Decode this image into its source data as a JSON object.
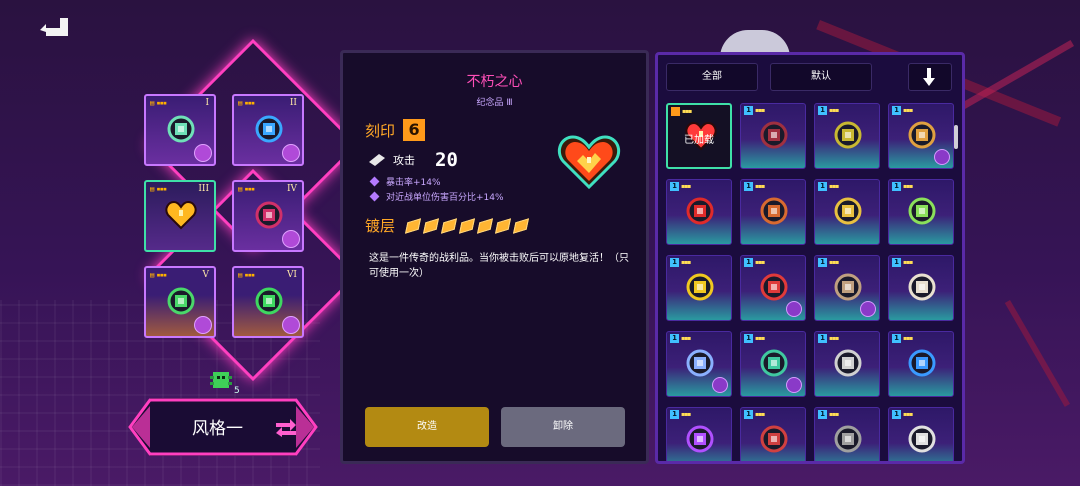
{
  "header": {
    "back_icon": "back-arrow-icon"
  },
  "equipped_slots": [
    {
      "numeral": "I",
      "rarity": "▤ ▪▪▪",
      "icon": "sword-gem-icon"
    },
    {
      "numeral": "II",
      "rarity": "▤ ▪▪▪",
      "icon": "eye-orb-icon"
    },
    {
      "numeral": "III",
      "rarity": "▤ ▪▪▪",
      "icon": "golden-heart-icon"
    },
    {
      "numeral": "IV",
      "rarity": "▤ ▪▪▪",
      "icon": "dark-crystal-icon"
    },
    {
      "numeral": "V",
      "rarity": "▤ ▪▪▪",
      "icon": "green-flower-icon"
    },
    {
      "numeral": "VI",
      "rarity": "▤ ▪▪▪",
      "icon": "green-cactus-icon"
    }
  ],
  "style": {
    "label": "风格一",
    "count": "5",
    "icon": "bug-icon",
    "swap_icon": "swap-arrows-icon"
  },
  "detail": {
    "title": "不朽之心",
    "subtitle": "纪念品 Ⅲ",
    "engrave_label": "刻印",
    "engrave_value": "6",
    "attack_label": "攻击",
    "attack_value": "20",
    "bonus_1": "暴击率+14%",
    "bonus_2": "对近战单位伤害百分比+14%",
    "plating_label": "镀层",
    "plating_level": 7,
    "description": "这是一件传奇的战利品。当你被击败后可以原地复活！（只可使用一次）",
    "reforge_button": "改造",
    "remove_button": "卸除"
  },
  "inventory": {
    "tab_all": "全部",
    "tab_default": "默认",
    "equipped_label": "已加载",
    "cells": [
      {
        "icon": "heart-icon",
        "equipped": true,
        "num": "",
        "num_orange": true
      },
      {
        "icon": "cannon-icon",
        "num": "1"
      },
      {
        "icon": "round-emblem-icon",
        "num": "1"
      },
      {
        "icon": "scroll-icon",
        "num": "1",
        "badge": true
      },
      {
        "icon": "red-v-orb-icon",
        "num": "1"
      },
      {
        "icon": "winged-gem-icon",
        "num": "1"
      },
      {
        "icon": "mask-icon",
        "num": "1"
      },
      {
        "icon": "potion-icon",
        "num": "1"
      },
      {
        "icon": "radiation-coin-icon",
        "num": "1"
      },
      {
        "icon": "card-icon",
        "num": "1",
        "badge": true
      },
      {
        "icon": "horns-icon",
        "num": "1",
        "badge": true
      },
      {
        "icon": "w-emblem-icon",
        "num": "1"
      },
      {
        "icon": "wrench-icon",
        "num": "1",
        "badge": true
      },
      {
        "icon": "compass-icon",
        "num": "1",
        "badge": true
      },
      {
        "icon": "bowl-icon",
        "num": "1"
      },
      {
        "icon": "clock-icon",
        "num": "1"
      },
      {
        "icon": "purple-gem-icon",
        "num": "1"
      },
      {
        "icon": "drum-icon",
        "num": "1"
      },
      {
        "icon": "canister-icon",
        "num": "1"
      },
      {
        "icon": "ring-icon",
        "num": "1"
      }
    ]
  },
  "colors": {
    "accent_pink": "#ff3fc0",
    "title_pink": "#ff4fb8",
    "orange": "#ffa726",
    "selection_green": "#3fe0a8"
  }
}
